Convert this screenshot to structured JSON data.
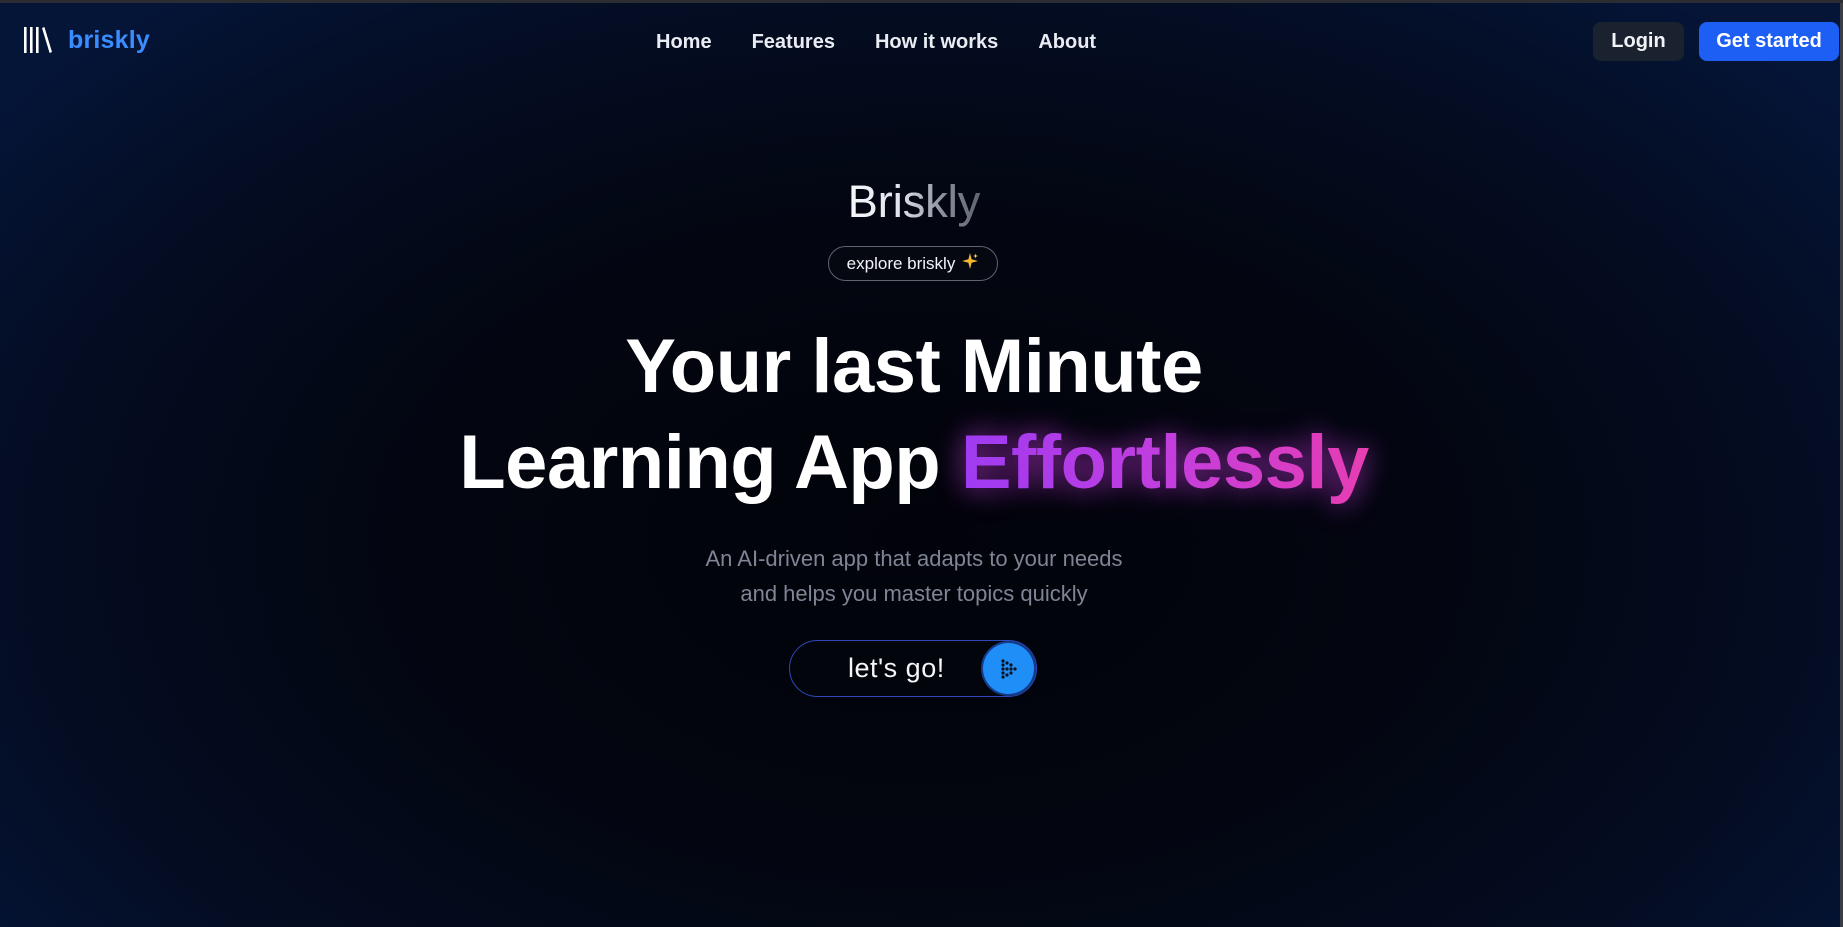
{
  "nav": {
    "brand_name": "briskly",
    "brand_icon": "library-books-icon",
    "links": [
      "Home",
      "Features",
      "How it works",
      "About"
    ],
    "login_label": "Login",
    "get_started_label": "Get started"
  },
  "hero": {
    "brand_title": "Briskly",
    "explore_pill": "explore briskly",
    "explore_icon": "sparkles-icon",
    "headline_line1": "Your last Minute",
    "headline_line2_plain": "Learning App",
    "headline_line2_highlight": "Effortlessly",
    "subtitle_line1": "An AI-driven app that adapts to your needs",
    "subtitle_line2": "and helps you master topics quickly",
    "cta_label": "let's go!",
    "cta_icon": "dotted-arrow-right-icon"
  },
  "colors": {
    "brand_blue": "#3a8dff",
    "primary_button": "#1d5ef5",
    "login_button": "#1a2230",
    "cta_circle": "#1f8ef7",
    "highlight_gradient_start": "#9a3cf5",
    "highlight_gradient_end": "#ec3fae",
    "background": "#020510"
  }
}
